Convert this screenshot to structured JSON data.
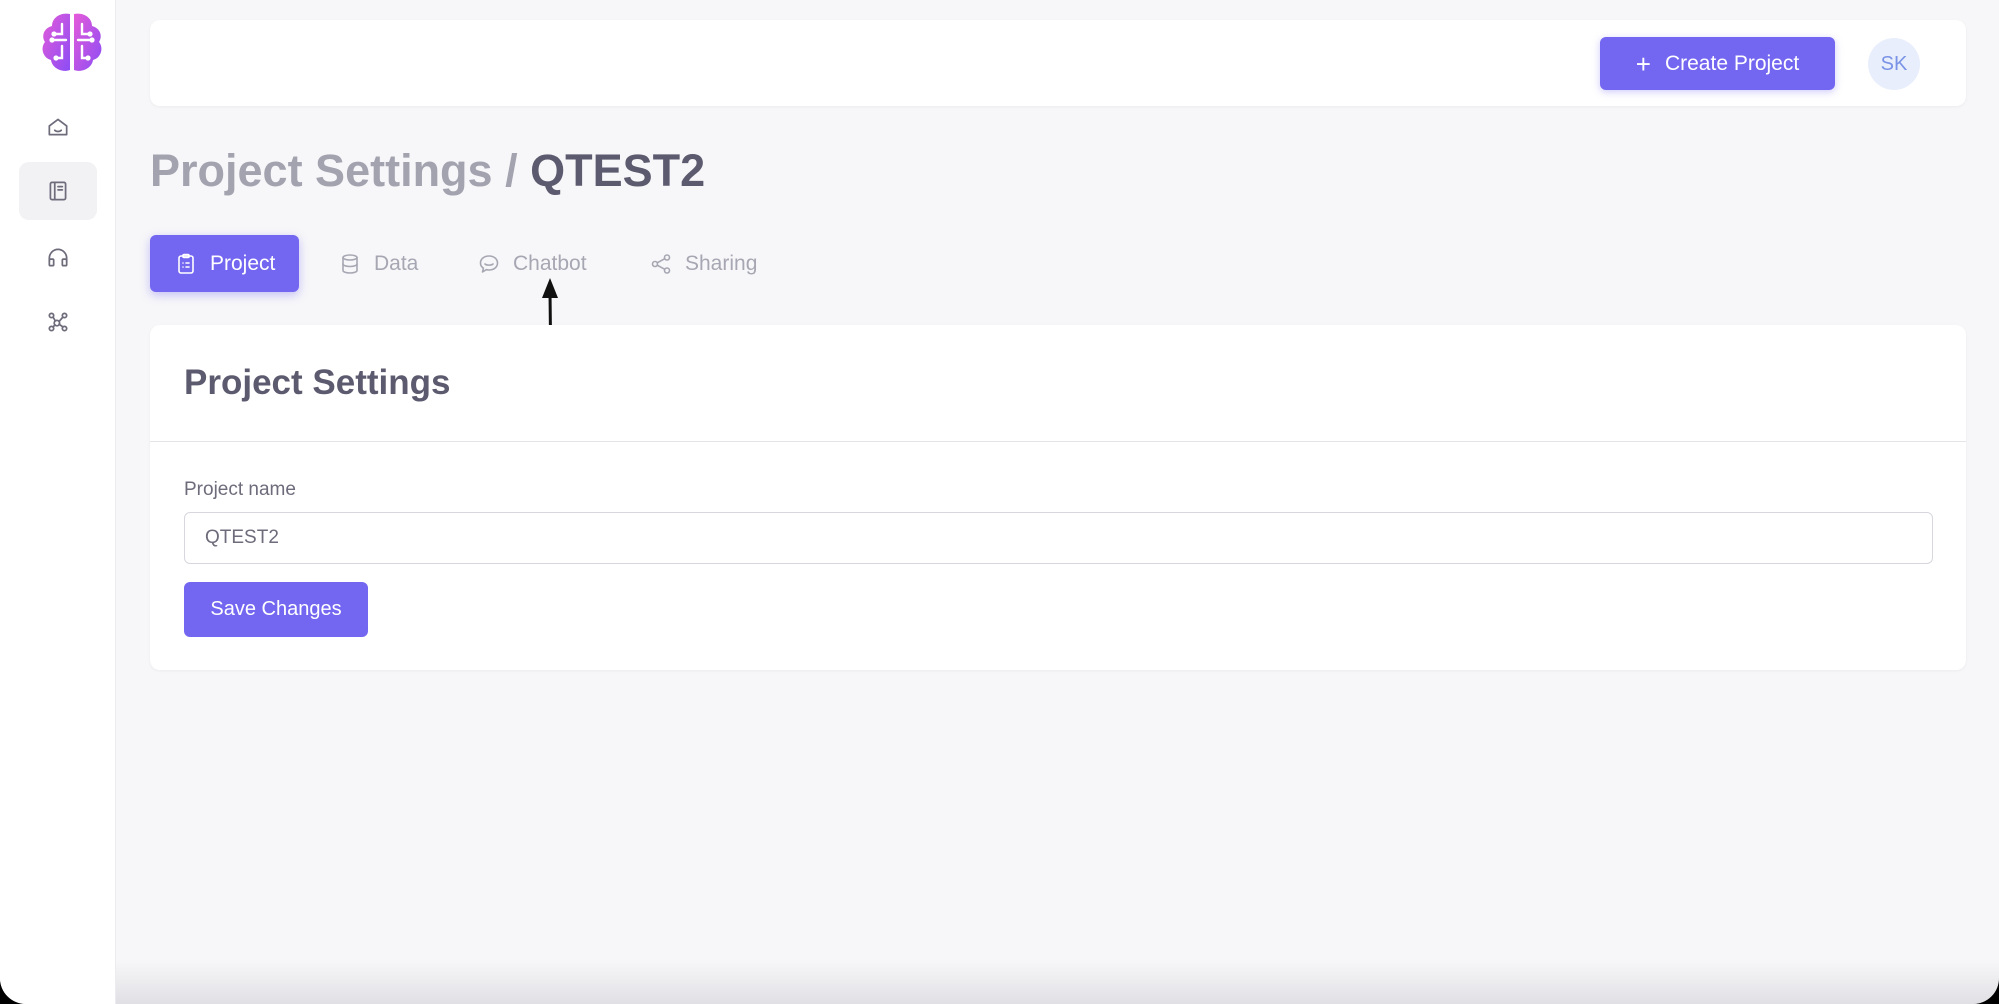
{
  "header": {
    "create_label": "Create Project",
    "avatar_initials": "SK"
  },
  "page": {
    "breadcrumb_section": "Project Settings",
    "breadcrumb_separator": "/",
    "project_title": "QTEST2"
  },
  "tabs": [
    {
      "label": "Project",
      "icon": "clipboard-icon",
      "active": true
    },
    {
      "label": "Data",
      "icon": "database-icon",
      "active": false
    },
    {
      "label": "Chatbot",
      "icon": "chat-bubble-icon",
      "active": false
    },
    {
      "label": "Sharing",
      "icon": "share-icon",
      "active": false
    }
  ],
  "sidebar": {
    "logo": "brain-circuit-logo",
    "items": [
      {
        "icon": "home-icon",
        "active": false
      },
      {
        "icon": "book-icon",
        "active": true
      },
      {
        "icon": "headphones-icon",
        "active": false
      },
      {
        "icon": "network-icon",
        "active": false
      }
    ]
  },
  "card": {
    "title": "Project Settings",
    "field_label": "Project name",
    "field_value": "QTEST2",
    "save_label": "Save Changes"
  },
  "colors": {
    "accent": "#7366f0",
    "background": "#f7f7f9",
    "heading": "#5c5a6e",
    "muted": "#a3a3b0"
  }
}
